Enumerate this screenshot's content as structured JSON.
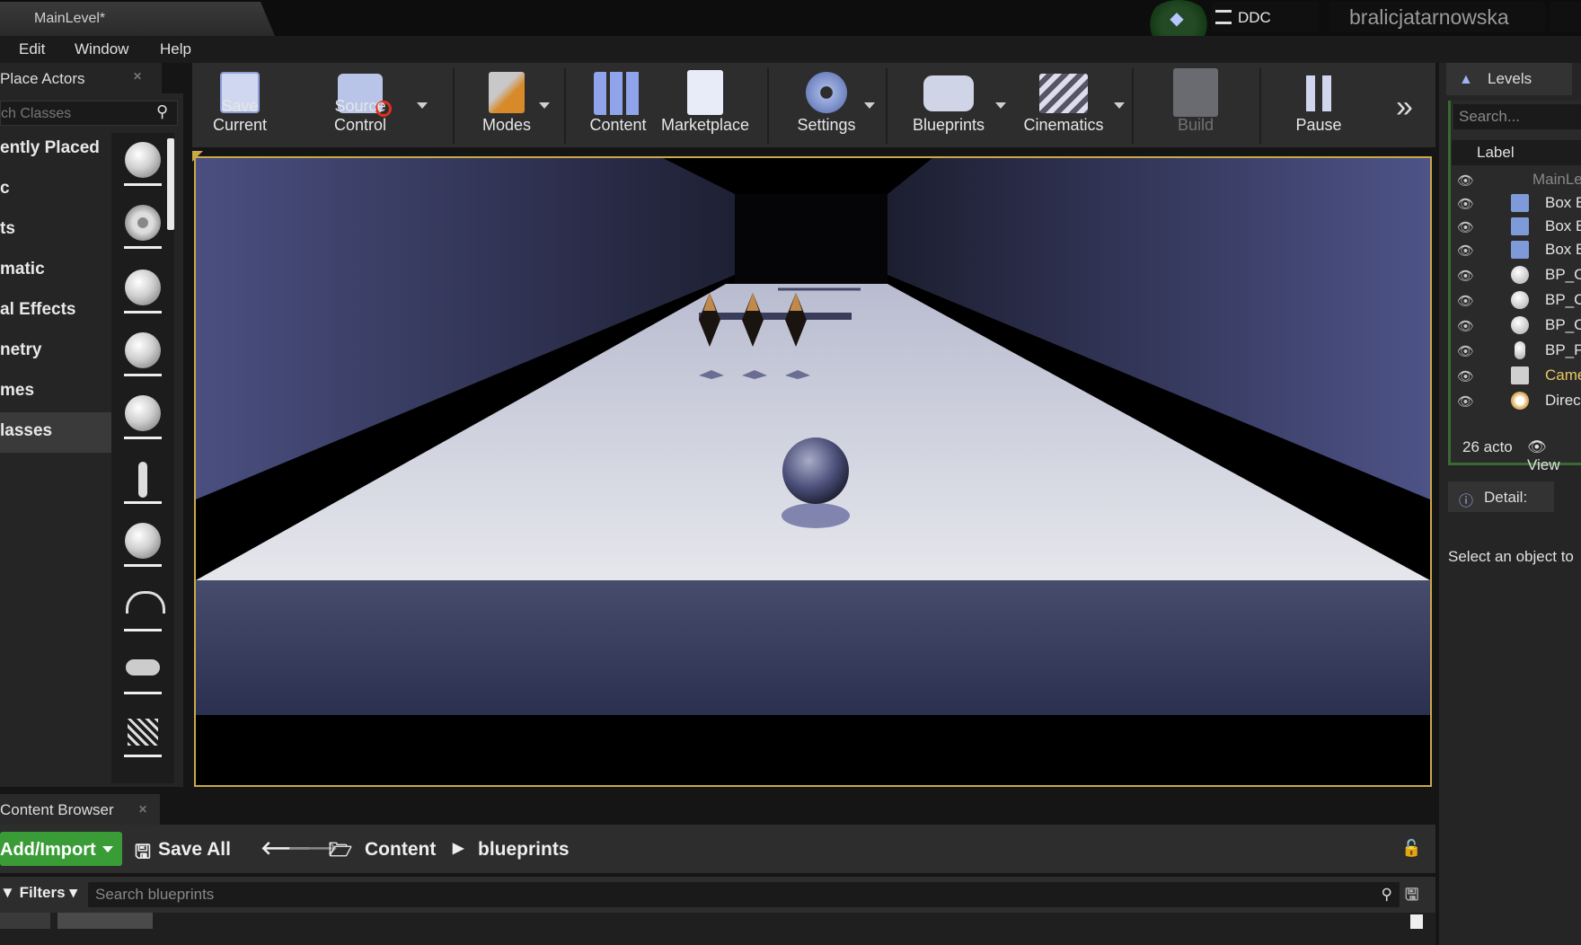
{
  "window": {
    "tab_title": "MainLevel*",
    "ddc_label": "DDC",
    "user_name": "bralicjatarnowska"
  },
  "menu": [
    "Edit",
    "Window",
    "Help"
  ],
  "place_actors": {
    "tab_label": "Place Actors",
    "search_placeholder": "ch Classes",
    "categories": [
      "ently Placed",
      "c",
      "ts",
      "matic",
      "al Effects",
      "netry",
      "mes",
      "lasses"
    ]
  },
  "toolbar": {
    "items": [
      "Save Current",
      "Source Control",
      "Modes",
      "Content",
      "Marketplace",
      "Settings",
      "Blueprints",
      "Cinematics",
      "Build",
      "Pause"
    ]
  },
  "levels": {
    "tab_label": "Levels",
    "search_placeholder": "Search...",
    "column_label": "Label",
    "rows": [
      "MainLe",
      "Box B",
      "Box B",
      "Box B",
      "BP_C",
      "BP_C",
      "BP_C",
      "BP_P",
      "Came",
      "Direc"
    ],
    "actor_count": "26 acto",
    "view_options": "View"
  },
  "details": {
    "tab_label": "Detail:",
    "empty_message": "Select an object to"
  },
  "content_browser": {
    "tab_label": "Content Browser",
    "add_import": "Add/Import",
    "save_all": "Save All",
    "path": [
      "Content",
      "blueprints"
    ],
    "filters_label": "Filters",
    "search_placeholder": "Search blueprints"
  },
  "colors": {
    "accent_gold": "#c9a94a",
    "add_green": "#3a9c36",
    "selection_green": "#3a6a33"
  }
}
